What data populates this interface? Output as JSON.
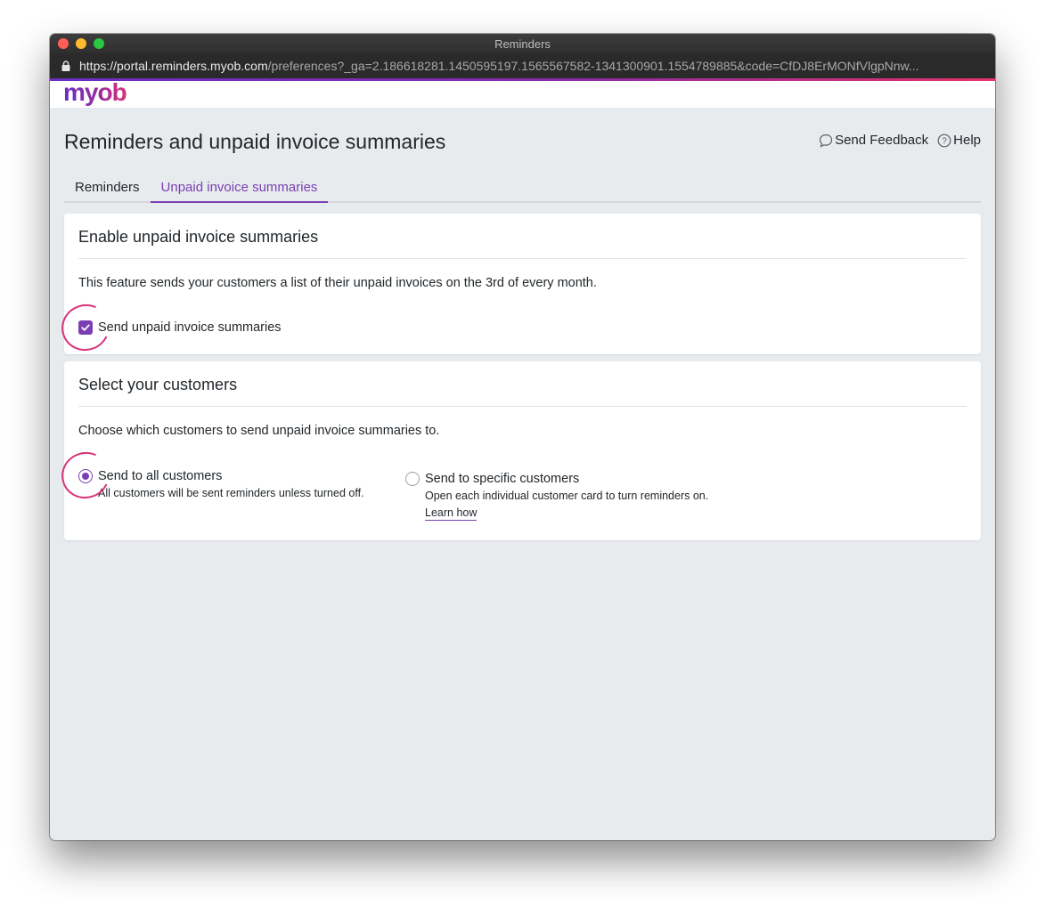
{
  "window": {
    "title": "Reminders"
  },
  "browser": {
    "url_host": "https://portal.reminders.myob.com",
    "url_path": "/preferences?_ga=2.186618281.1450595197.1565567582-1341300901.1554789885&code=CfDJ8ErMONfVlgpNnw..."
  },
  "brand": {
    "logo_text": "myob",
    "accent": "#7a3fb4",
    "gradient_end": "#e8326a"
  },
  "page": {
    "title": "Reminders and unpaid invoice summaries",
    "actions": {
      "feedback": "Send Feedback",
      "help": "Help"
    }
  },
  "tabs": [
    {
      "label": "Reminders",
      "active": false
    },
    {
      "label": "Unpaid invoice summaries",
      "active": true
    }
  ],
  "enable_card": {
    "title": "Enable unpaid invoice summaries",
    "description": "This feature sends your customers a list of their unpaid invoices on the 3rd of every month.",
    "checkbox_label": "Send unpaid invoice summaries",
    "checked": true
  },
  "customers_card": {
    "title": "Select your customers",
    "description": "Choose which customers to send unpaid invoice summaries to.",
    "options": [
      {
        "label": "Send to all customers",
        "help": "All customers will be sent reminders unless turned off.",
        "checked": true
      },
      {
        "label": "Send to specific customers",
        "help": "Open each individual customer card to turn reminders on.",
        "link": "Learn how",
        "checked": false
      }
    ]
  }
}
